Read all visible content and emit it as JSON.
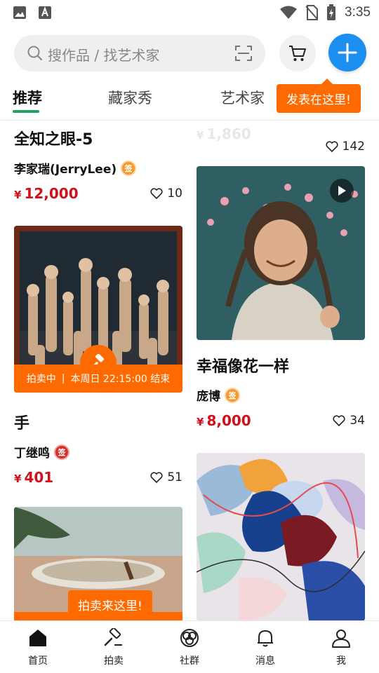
{
  "status_bar": {
    "time": "3:35"
  },
  "search": {
    "placeholder": "搜作品 / 找艺术家"
  },
  "tabs": [
    {
      "label": "推荐",
      "active": true
    },
    {
      "label": "藏家秀",
      "active": false
    },
    {
      "label": "艺术家",
      "active": false
    }
  ],
  "tips": {
    "publish": "发表在这里!",
    "auction": "拍卖来这里!"
  },
  "left_column": {
    "card1": {
      "title": "全知之眼-5",
      "artist": "李家瑞(JerryLee)",
      "currency": "¥",
      "price": "12,000",
      "likes": "10"
    },
    "card2": {
      "auction_status": "拍卖中",
      "auction_end": "本周日 22:15:00 结束",
      "title": "手",
      "artist": "丁继鸣",
      "currency": "¥",
      "price": "401",
      "likes": "51"
    }
  },
  "right_column": {
    "card1": {
      "currency": "¥",
      "price": "1,860",
      "likes": "142"
    },
    "card2": {
      "title": "幸福像花一样",
      "artist": "庞博",
      "currency": "¥",
      "price": "8,000",
      "likes": "34"
    }
  },
  "badge_text": "签",
  "bottom_nav": [
    {
      "label": "首页",
      "icon": "home-icon"
    },
    {
      "label": "拍卖",
      "icon": "gavel-icon"
    },
    {
      "label": "社群",
      "icon": "community-icon"
    },
    {
      "label": "消息",
      "icon": "bell-icon"
    },
    {
      "label": "我",
      "icon": "user-icon"
    }
  ],
  "colors": {
    "accent_blue": "#1d8ff0",
    "accent_orange": "#ff6a00",
    "price_red": "#d0101a",
    "tab_green": "#20a060"
  }
}
